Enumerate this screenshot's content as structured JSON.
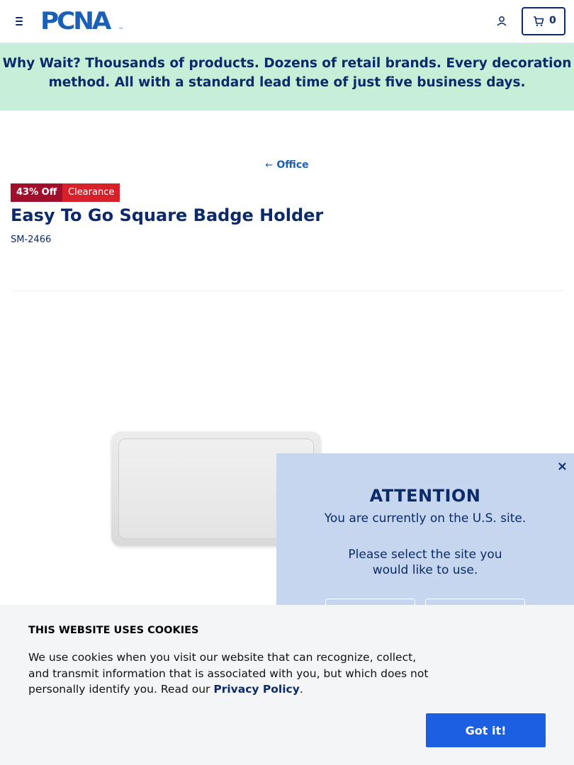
{
  "header": {
    "logo_text": "PCNA",
    "logo_tm": "™",
    "cart_count": "0"
  },
  "promo": {
    "lead": "Why Wait?",
    "text": " Thousands of products. Dozens of retail brands. Every decoration method. All with a standard lead time of just five business days."
  },
  "breadcrumb": {
    "arrow": "←",
    "label": "Office"
  },
  "product": {
    "badges": {
      "discount": "43% Off",
      "clearance": "Clearance"
    },
    "title": "Easy To Go Square Badge Holder",
    "sku": "SM-2466"
  },
  "attention": {
    "close": "×",
    "title": "ATTENTION",
    "message1": "You are currently on the U.S. site.",
    "message2": "Please select the site you would like to use."
  },
  "cookies": {
    "title": "THIS WEBSITE USES COOKIES",
    "body": "We use cookies when you visit our website that can recognize, collect, and transmit information that is associated with you, but which does not personally identify you. Read our ",
    "link": "Privacy Policy",
    "period": ".",
    "button": "Got it!"
  },
  "colors": {
    "navy": "#0b2a6b",
    "blue": "#1c5fb6",
    "promo_bg": "#c7efd8",
    "discount_badge": "#a0102c",
    "clearance_badge": "#d6202a",
    "attention_bg": "#c6d6ee",
    "cookie_bg": "#f4f5f7",
    "button_blue": "#1c5fe0"
  },
  "icons": {
    "menu": "hamburger-icon",
    "account": "user-icon",
    "cart": "cart-icon"
  }
}
